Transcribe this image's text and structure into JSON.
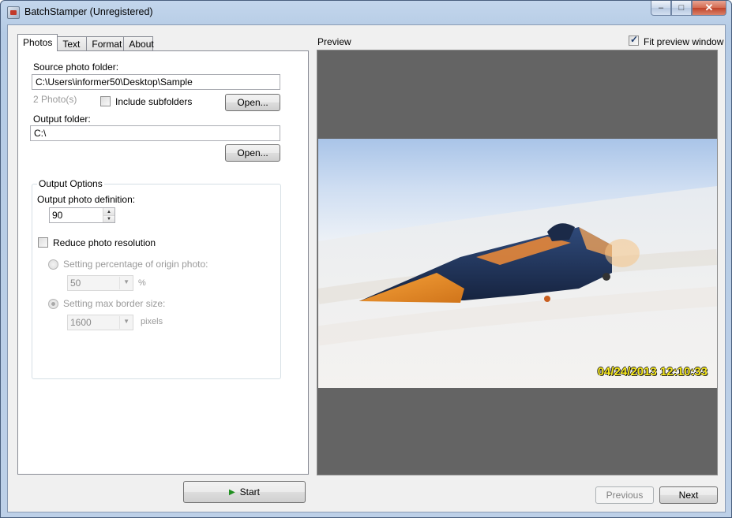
{
  "window": {
    "title": "BatchStamper (Unregistered)",
    "controls": {
      "minimize": "–",
      "maximize": "□",
      "close": "✕"
    }
  },
  "tabs": [
    {
      "label": "Photos",
      "active": true
    },
    {
      "label": "Text",
      "active": false
    },
    {
      "label": "Format",
      "active": false
    },
    {
      "label": "About",
      "active": false
    }
  ],
  "photos_tab": {
    "source_label": "Source photo folder:",
    "source_value": "C:\\Users\\informer50\\Desktop\\Sample",
    "photo_count": "2 Photo(s)",
    "include_subfolders_label": "Include subfolders",
    "include_subfolders_checked": false,
    "open_source_label": "Open...",
    "output_label": "Output folder:",
    "output_value": "C:\\",
    "open_output_label": "Open...",
    "output_options": {
      "legend": "Output Options",
      "definition_label": "Output photo definition:",
      "definition_value": "90",
      "reduce_label": "Reduce photo resolution",
      "reduce_checked": false,
      "percentage_label": "Setting percentage of origin photo:",
      "percentage_value": "50",
      "percentage_unit": "%",
      "max_border_label": "Setting max border size:",
      "max_border_value": "1600",
      "max_border_unit": "pixels",
      "selected_mode": "max_border"
    }
  },
  "start_button": "Start",
  "preview": {
    "label": "Preview",
    "fit_label": "Fit preview window",
    "fit_checked": true,
    "stamp_text": "04/24/2013 12:10:33",
    "stamp_color": "#f6e81d"
  },
  "nav": {
    "previous": "Previous",
    "previous_enabled": false,
    "next": "Next"
  }
}
